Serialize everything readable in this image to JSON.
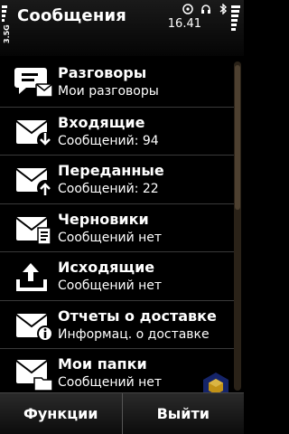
{
  "header": {
    "title": "Сообщения",
    "time": "16.41",
    "network_label": "3.5G"
  },
  "items": [
    {
      "title": "Разговоры",
      "subtitle": "Мои разговоры",
      "icon": "conversations-icon"
    },
    {
      "title": "Входящие",
      "subtitle": "Сообщений: 94",
      "icon": "inbox-icon"
    },
    {
      "title": "Переданные",
      "subtitle": "Сообщений: 22",
      "icon": "sent-icon"
    },
    {
      "title": "Черновики",
      "subtitle": "Сообщений нет",
      "icon": "drafts-icon"
    },
    {
      "title": "Исходящие",
      "subtitle": "Сообщений нет",
      "icon": "outbox-icon"
    },
    {
      "title": "Отчеты о доставке",
      "subtitle": "Информац. о доставке",
      "icon": "delivery-reports-icon"
    },
    {
      "title": "Мои папки",
      "subtitle": "Сообщений нет",
      "icon": "my-folders-icon"
    }
  ],
  "softkeys": {
    "left": "Функции",
    "right": "Выйти"
  },
  "colors": {
    "background": "#000000",
    "text": "#ffffff",
    "divider": "#3a3a3a",
    "scroll_track": "#2a2218"
  }
}
